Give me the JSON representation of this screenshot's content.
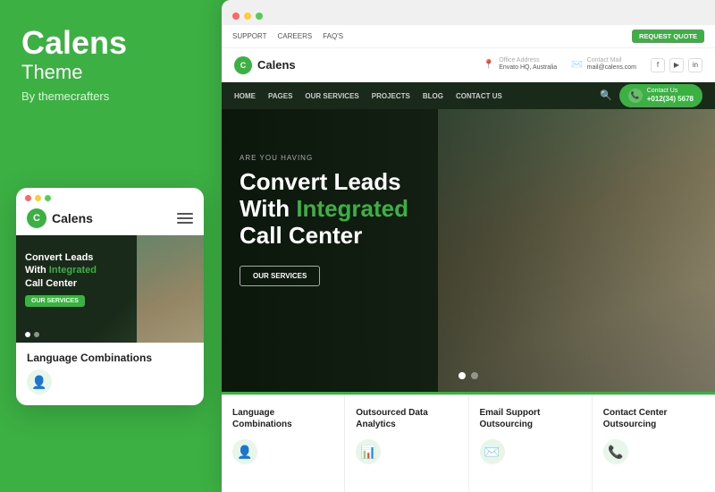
{
  "leftPanel": {
    "brandName": "Calens",
    "brandSub": "Theme",
    "byLine": "By themecrafters"
  },
  "mobileCard": {
    "dots": [
      "red",
      "yellow",
      "green"
    ],
    "logoName": "Calens",
    "hero": {
      "preLine": "",
      "headingLine1": "Convert Leads",
      "headingLine2": "With",
      "headingHighlight": "Integrated",
      "headingLine3": "Call Center",
      "ctaLabel": "OUR SERVICES"
    },
    "langCard": {
      "title": "Language Combinations"
    }
  },
  "browser": {
    "dots": [
      "#f66",
      "#fc3",
      "#5c5"
    ]
  },
  "topbar": {
    "links": [
      "SUPPORT",
      "CAREERS",
      "FAQ'S"
    ],
    "ctaLabel": "REQUEST QUOTE"
  },
  "header": {
    "logoName": "Calens",
    "officeLabel": "Office Address",
    "officeValue": "Envato HQ, Australia",
    "mailLabel": "Contact Mail",
    "mailValue": "mail@calens.com",
    "socials": [
      "f",
      "▶",
      "in"
    ]
  },
  "nav": {
    "links": [
      "HOME",
      "PAGES",
      "OUR SERVICES",
      "PROJECTS",
      "BLOG",
      "CONTACT US"
    ],
    "contactBtn": {
      "label": "Contact Us",
      "phone": "+012(34) 5678"
    }
  },
  "hero": {
    "preLine": "ARE YOU HAVING",
    "headingLine1": "Convert Leads",
    "headingLine2": "With",
    "headingHighlight": "Integrated",
    "headingLine3": "Call Center",
    "ctaLabel": "OUR SERVICES",
    "sliderDots": [
      "active",
      "",
      ""
    ]
  },
  "bottomCards": [
    {
      "title": "Language Combinations",
      "icon": "👤"
    },
    {
      "title": "Outsourced Data Analytics",
      "icon": "📊"
    },
    {
      "title": "Email Support Outsourcing",
      "icon": "✉️"
    },
    {
      "title": "Contact Center Outsourcing",
      "icon": "📞"
    }
  ]
}
